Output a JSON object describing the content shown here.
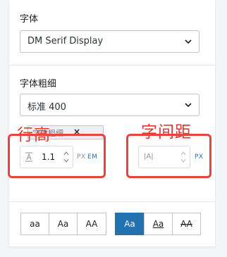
{
  "font_family": {
    "label": "字体",
    "value": "DM Serif Display"
  },
  "font_weight": {
    "label": "字体粗细",
    "value": "标准 400",
    "tag": "字体粗细"
  },
  "annotations": {
    "line_height": "行高",
    "letter_spacing": "字间距"
  },
  "line_height_control": {
    "value": "1.1",
    "units": [
      "PX",
      "EM"
    ],
    "active_unit": "EM"
  },
  "letter_spacing_control": {
    "icon_text": "|A|",
    "value": "",
    "units": [
      "PX"
    ],
    "active_unit": "PX"
  },
  "transform_buttons": [
    {
      "label": "aa"
    },
    {
      "label": "Aa"
    },
    {
      "label": "AA"
    }
  ],
  "decoration_buttons": [
    {
      "label": "Aa",
      "active": true
    },
    {
      "label": "Aa",
      "style": "underline"
    },
    {
      "label": "AA",
      "style": "strikethrough"
    }
  ],
  "colors": {
    "accent": "#2271b1",
    "annotation_red": "#e8372f"
  }
}
